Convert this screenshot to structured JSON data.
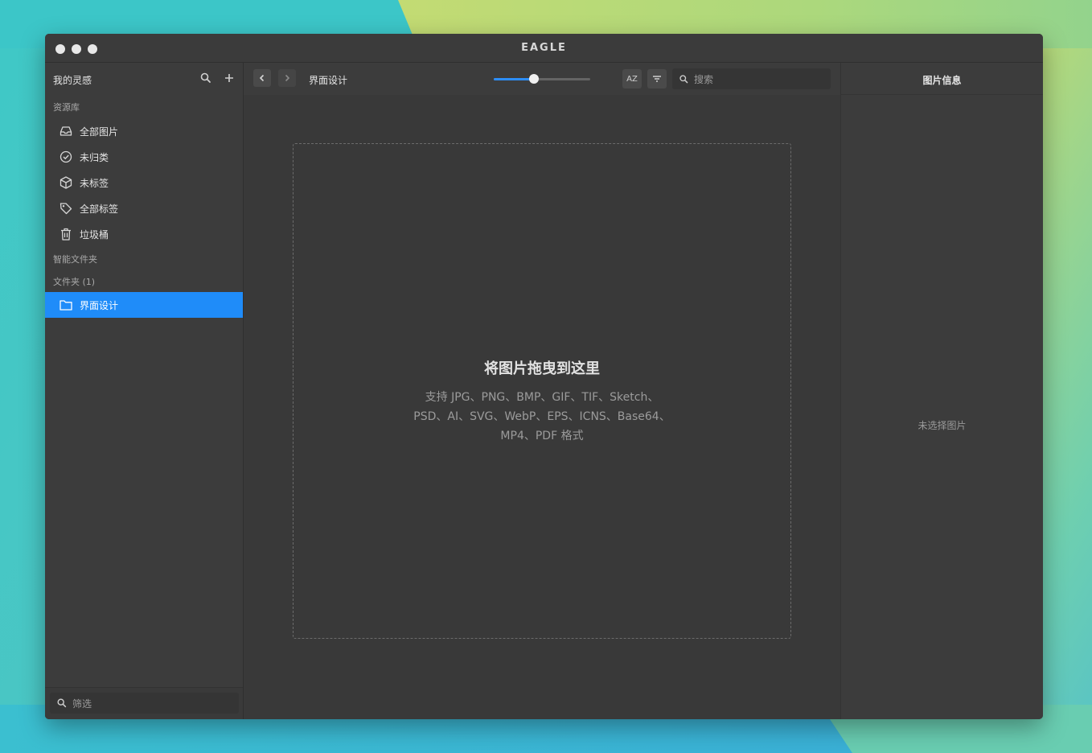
{
  "window": {
    "title": "EAGLE"
  },
  "sidebar": {
    "title": "我的灵感",
    "library_label": "资源库",
    "items": [
      {
        "label": "全部图片",
        "icon": "inbox-icon"
      },
      {
        "label": "未归类",
        "icon": "check-circle-icon"
      },
      {
        "label": "未标签",
        "icon": "box-icon"
      },
      {
        "label": "全部标签",
        "icon": "tag-icon"
      },
      {
        "label": "垃圾桶",
        "icon": "trash-icon"
      }
    ],
    "smart_folders_label": "智能文件夹",
    "folders_label": "文件夹 (1)",
    "folders": [
      {
        "label": "界面设计",
        "icon": "folder-icon"
      }
    ],
    "filter_placeholder": "筛选"
  },
  "toolbar": {
    "breadcrumb": "界面设计",
    "zoom_level": 0.42,
    "sort_label": "AZ",
    "search_placeholder": "搜索"
  },
  "dropzone": {
    "title": "将图片拖曳到这里",
    "desc_line1": "支持 JPG、PNG、BMP、GIF、TIF、Sketch、",
    "desc_line2": "PSD、AI、SVG、WebP、EPS、ICNS、Base64、",
    "desc_line3": "MP4、PDF 格式"
  },
  "inspector": {
    "title": "图片信息",
    "empty_text": "未选择图片"
  },
  "colors": {
    "accent": "#1f8cf9",
    "window_bg": "#3a3a3a"
  }
}
